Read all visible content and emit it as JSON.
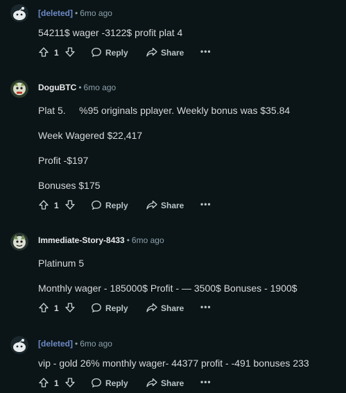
{
  "comments": [
    {
      "author": "[deleted]",
      "time": "6mo ago",
      "lines": [
        "54211$ wager -3122$ profit plat 4"
      ],
      "votes": "1",
      "reply_label": "Reply",
      "share_label": "Share",
      "more_label": "•••"
    },
    {
      "author": "DoguBTC",
      "time": "6mo ago",
      "lines": [
        "Plat 5.     %95 originals pplayer. Weekly bonus was $35.84",
        "Week Wagered $22,417",
        "Profit -$197",
        "Bonuses $175"
      ],
      "votes": "1",
      "reply_label": "Reply",
      "share_label": "Share",
      "more_label": "•••"
    },
    {
      "author": "Immediate-Story-8433",
      "time": "6mo ago",
      "lines": [
        "Platinum 5",
        "Monthly wager - 185000$ Profit - — 3500$ Bonuses - 1900$"
      ],
      "votes": "1",
      "reply_label": "Reply",
      "share_label": "Share",
      "more_label": "•••"
    },
    {
      "author": "[deleted]",
      "time": "6mo ago",
      "lines": [
        "vip - gold 26% monthly wager- 44377 profit - -491 bonuses 233"
      ],
      "votes": "1",
      "reply_label": "Reply",
      "share_label": "Share",
      "more_label": "•••"
    }
  ],
  "separator": "•",
  "icons": {
    "upvote": "upvote-icon",
    "downvote": "downvote-icon",
    "reply": "reply-icon",
    "share": "share-icon",
    "more": "more-icon",
    "deleted_avatar": "reddit-snoo-avatar",
    "user_avatar": "user-avatar"
  },
  "colors": {
    "background": "#0b1416",
    "deleted_author": "#6d8ac6",
    "meta": "#8ba2ad",
    "text": "#d7dadc"
  }
}
